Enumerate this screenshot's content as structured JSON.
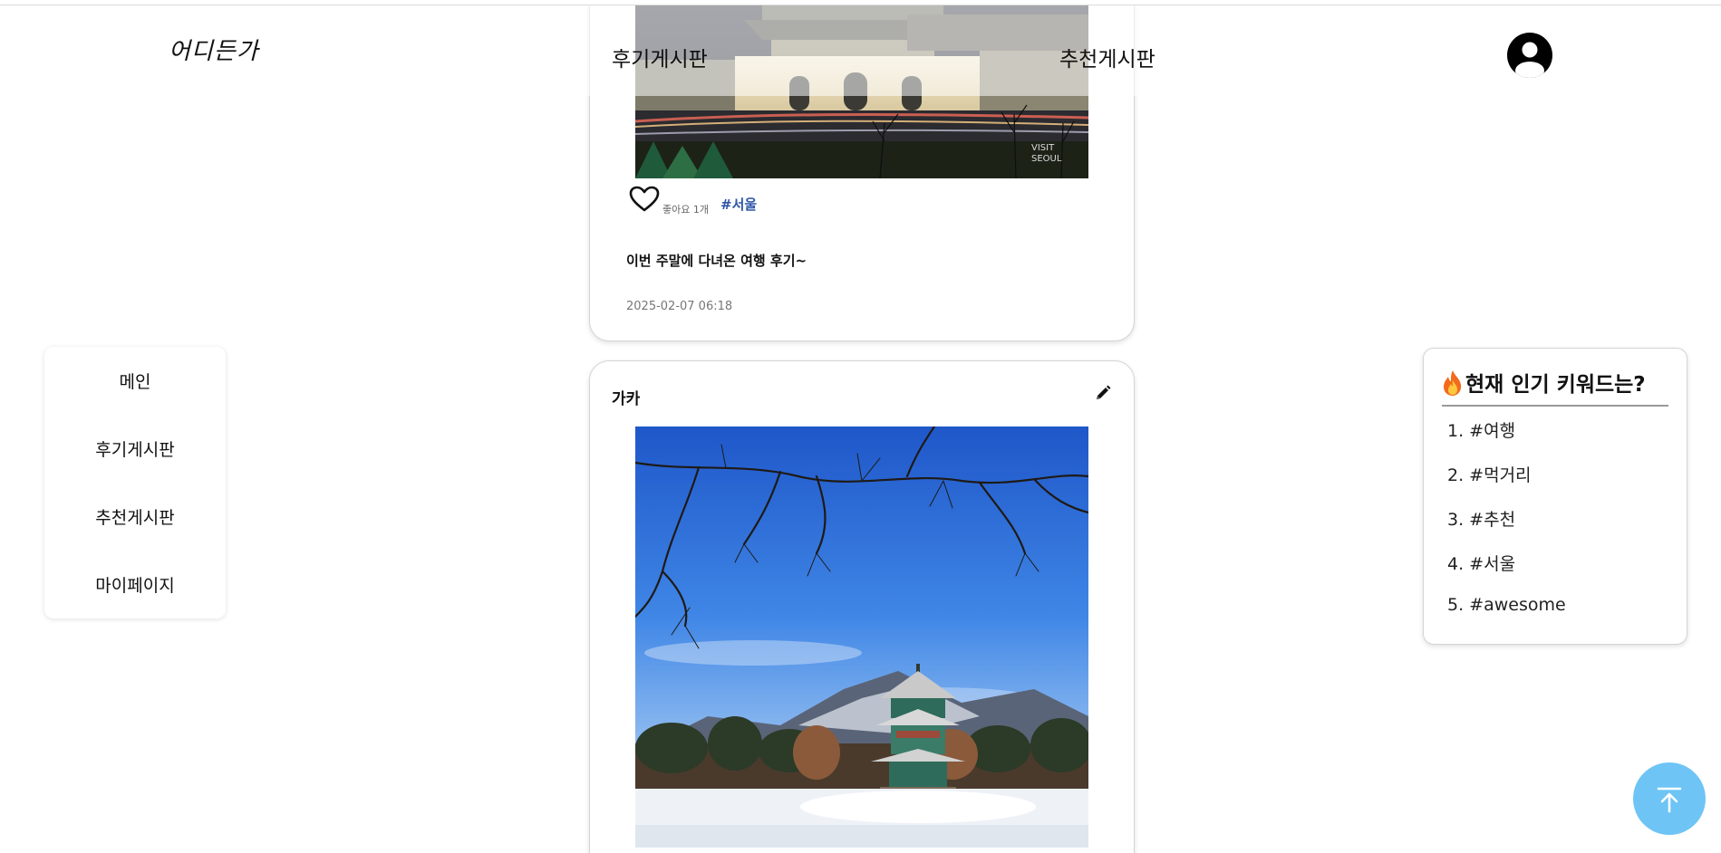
{
  "header": {
    "logo": "어디든가",
    "nav": {
      "review_board": "후기게시판",
      "recommend_board": "추천게시판"
    },
    "profile_icon": "user-circle-icon"
  },
  "sidebar": {
    "items": [
      {
        "label": "메인"
      },
      {
        "label": "후기게시판"
      },
      {
        "label": "추천게시판"
      },
      {
        "label": "마이페이지"
      }
    ]
  },
  "posts": [
    {
      "image_subject": "gyeongbokgung-night-photo",
      "like_icon": "heart-outline-icon",
      "like_count": "좋아요 1개",
      "tag": "#서울",
      "text": "이번 주말에 다녀온 여행 후기~",
      "date": "2025-02-07 06:18"
    },
    {
      "author": "가카",
      "edit_icon": "pencil-icon",
      "image_subject": "palace-pavilion-winter-photo"
    }
  ],
  "keywords": {
    "title": "현재 인기 키워드는?",
    "title_icon": "fire-icon",
    "items": [
      {
        "label": "1. #여행"
      },
      {
        "label": "2. #먹거리"
      },
      {
        "label": "3. #추천"
      },
      {
        "label": "4. #서울"
      },
      {
        "label": "5. #awesome"
      }
    ]
  },
  "scroll_top": {
    "icon": "arrow-up-to-top-icon",
    "color": "#6ec4f5"
  },
  "colors": {
    "tag": "#2e56a6",
    "accent": "#6ec4f5"
  }
}
